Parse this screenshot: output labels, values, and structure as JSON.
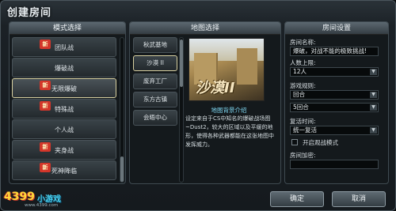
{
  "window": {
    "title": "创建房间"
  },
  "mode_panel": {
    "header": "模式选择",
    "items": [
      {
        "label": "团队战",
        "is_new": true,
        "selected": false
      },
      {
        "label": "爆破战",
        "is_new": false,
        "selected": false
      },
      {
        "label": "无限爆破",
        "is_new": true,
        "selected": true
      },
      {
        "label": "特殊战",
        "is_new": true,
        "selected": false
      },
      {
        "label": "个人战",
        "is_new": false,
        "selected": false
      },
      {
        "label": "夹身战",
        "is_new": true,
        "selected": false
      },
      {
        "label": "死神降临",
        "is_new": true,
        "selected": false
      }
    ],
    "new_badge_text": "新"
  },
  "map_panel": {
    "header": "地图选择",
    "items": [
      {
        "label": "秋武基地",
        "selected": false
      },
      {
        "label": "沙漠 II",
        "selected": true
      },
      {
        "label": "废弃工厂",
        "selected": false
      },
      {
        "label": "东方古镇",
        "selected": false
      },
      {
        "label": "会晤中心",
        "selected": false
      }
    ],
    "preview_title": "沙漠II",
    "desc_title": "地图背景介绍",
    "description": "设定来自于CS中知名的爆破战场图~Dust2，较大的区域以及平缓的地形，使得各种武器都能在这张地图中发挥威力。"
  },
  "settings_panel": {
    "header": "房间设置",
    "room_name_label": "房间名称:",
    "room_name_value": "爆破，对战不能的极致挑战!",
    "max_players_label": "人数上限:",
    "max_players_value": "12人",
    "rule_label": "游戏规则:",
    "rule_value": "回合",
    "round_value": "5回合",
    "respawn_label": "复活时间:",
    "respawn_value": "统一复活",
    "spectate_label": "开启观战模式",
    "password_label": "房间加密:",
    "password_value": ""
  },
  "buttons": {
    "confirm": "确定",
    "cancel": "取消"
  },
  "logo": {
    "main": "4399",
    "sub": "小游戏",
    "url": "www.4399.com"
  },
  "colors": {
    "accent_new": "#d3362a",
    "selected_border": "#d8d0a0",
    "desc_title": "#7ed6f0"
  }
}
